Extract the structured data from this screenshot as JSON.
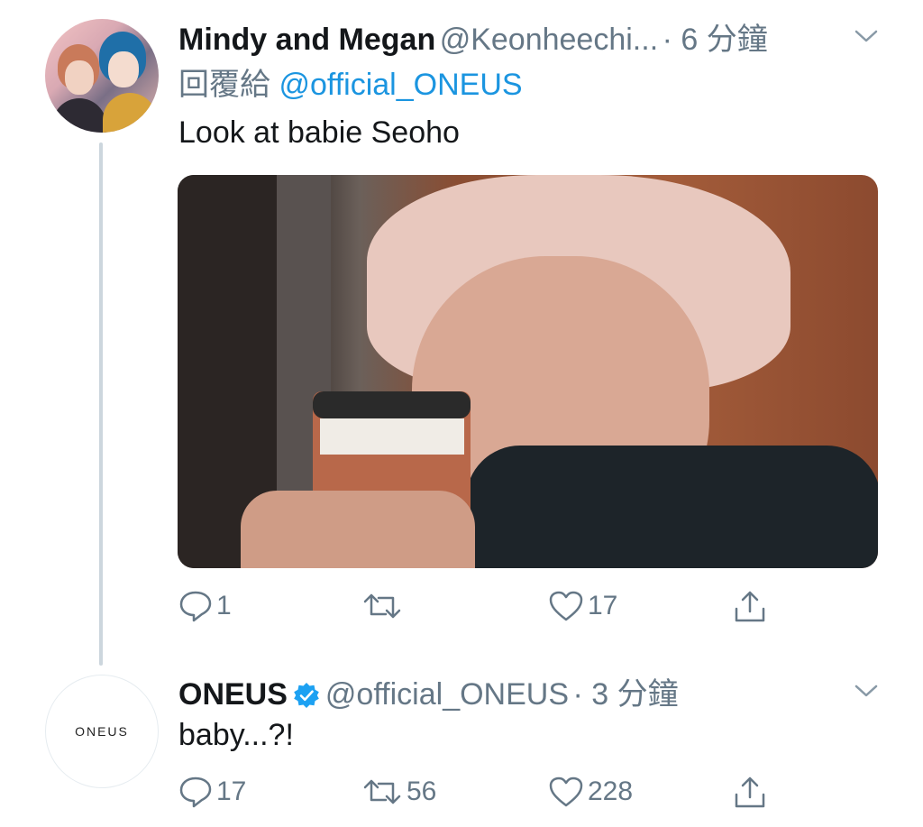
{
  "tweet1": {
    "display_name": "Mindy and Megan",
    "handle": "@Keonheechi...",
    "time": "· 6 分鐘",
    "reply_prefix": "回覆給",
    "reply_to": "@official_ONEUS",
    "text": "Look at babie Seoho",
    "actions": {
      "replies": "1",
      "retweets": "",
      "likes": "17"
    }
  },
  "tweet2": {
    "display_name": "ONEUS",
    "handle": "@official_ONEUS",
    "time": "· 3 分鐘",
    "avatar_text": "ONEUS",
    "text": "baby...?!",
    "actions": {
      "replies": "17",
      "retweets": "56",
      "likes": "228"
    }
  },
  "colors": {
    "link": "#1b95e0",
    "muted": "#657786",
    "thread_line": "#ccd6dd",
    "verified": "#1da1f2"
  }
}
